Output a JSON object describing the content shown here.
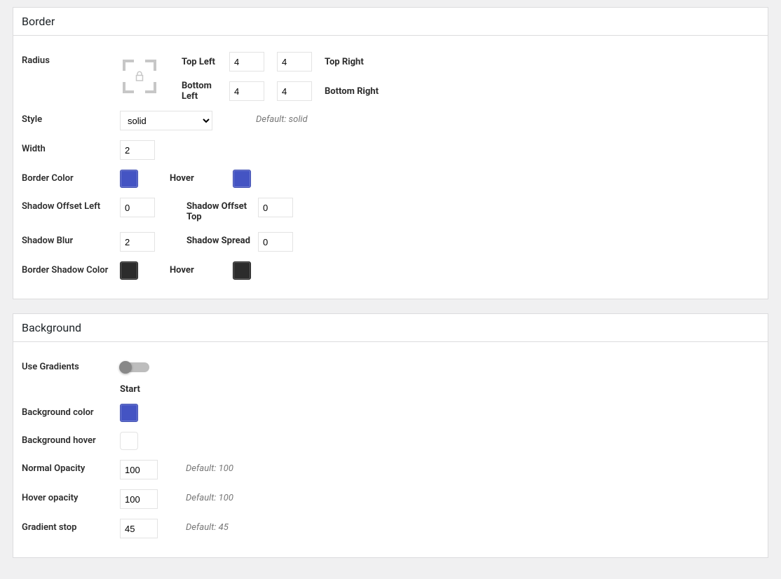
{
  "border": {
    "title": "Border",
    "radius": {
      "label": "Radius",
      "top_left_label": "Top Left",
      "top_left_value": "4",
      "top_right_label": "Top Right",
      "top_right_value": "4",
      "bottom_left_label": "Bottom Left",
      "bottom_left_value": "4",
      "bottom_right_label": "Bottom Right",
      "bottom_right_value": "4"
    },
    "style": {
      "label": "Style",
      "value": "solid",
      "hint": "Default: solid"
    },
    "width": {
      "label": "Width",
      "value": "2"
    },
    "border_color": {
      "label": "Border Color",
      "color": "#4454c3",
      "hover_label": "Hover",
      "hover_color": "#4454c3"
    },
    "shadow_offset_left": {
      "label": "Shadow Offset Left",
      "value": "0"
    },
    "shadow_offset_top": {
      "label": "Shadow Offset Top",
      "value": "0"
    },
    "shadow_blur": {
      "label": "Shadow Blur",
      "value": "2"
    },
    "shadow_spread": {
      "label": "Shadow Spread",
      "value": "0"
    },
    "border_shadow_color": {
      "label": "Border Shadow Color",
      "color": "#2c2c2c",
      "hover_label": "Hover",
      "hover_color": "#2c2c2c"
    }
  },
  "background": {
    "title": "Background",
    "use_gradients": {
      "label": "Use Gradients",
      "on": false
    },
    "start_label": "Start",
    "bg_color": {
      "label": "Background color",
      "color": "#4454c3"
    },
    "bg_hover": {
      "label": "Background hover",
      "color": "#ffffff"
    },
    "normal_opacity": {
      "label": "Normal Opacity",
      "value": "100",
      "hint": "Default: 100"
    },
    "hover_opacity": {
      "label": "Hover opacity",
      "value": "100",
      "hint": "Default: 100"
    },
    "gradient_stop": {
      "label": "Gradient stop",
      "value": "45",
      "hint": "Default: 45"
    }
  }
}
